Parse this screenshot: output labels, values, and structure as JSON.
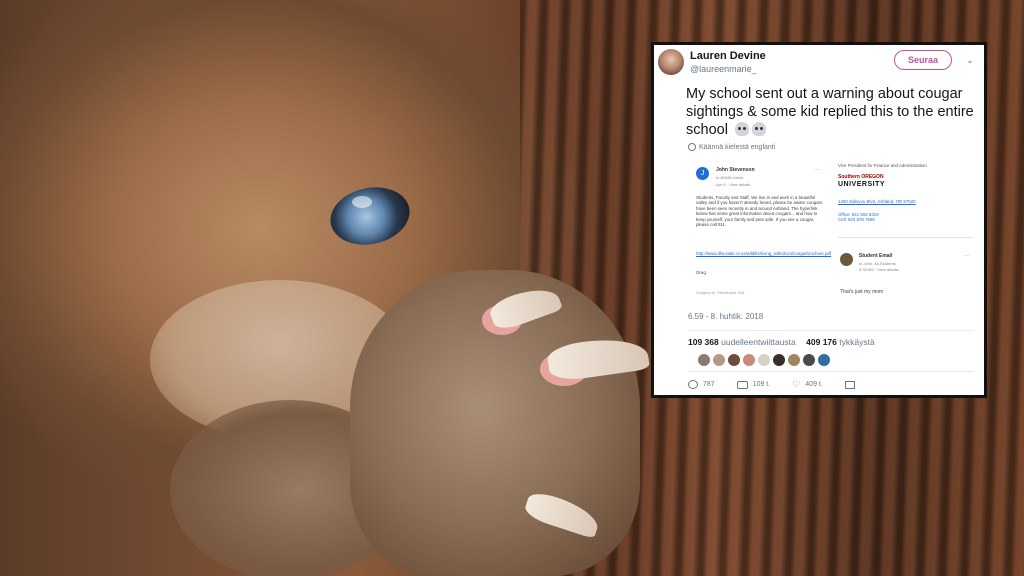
{
  "tweet": {
    "author_name": "Lauren Devine",
    "author_handle": "@laureenmarie_",
    "follow_label": "Seuraa",
    "text": "My school sent out a warning about cougar sightings & some kid replied this to the entire school",
    "translate_label": "Käännä kielestä englanti",
    "timestamp": "6.59 - 8. huhtik. 2018",
    "retweets_count": "109 368",
    "retweets_label": "uudelleentwiittausta",
    "likes_count": "409 176",
    "likes_label": "tykkäystä",
    "reply_count": "787",
    "retweet_action_count": "109 t.",
    "like_action_count": "409 t.",
    "icons": [
      "chevron-down-icon",
      "globe-icon",
      "reply-icon",
      "retweet-icon",
      "like-icon",
      "message-icon"
    ],
    "accent_color": "#c1539d"
  },
  "embedded_email": {
    "sender_initial": "J",
    "sender_name": "John Stevenson",
    "to_line": "to ANNN-Users",
    "date_line": "Apr 6 · View details",
    "body": "Students, Faculty and Staff, We live in and work in a beautiful valley and if you haven't already heard, please be aware cougars have been seen recently in and around Ashland. The hyperlink below has some great information about cougars... and how to keep yourself, your family and pets safe. If you see a cougar, please call 911.",
    "link": "http://www.dfw.state.or.us/wildlife/living_with/docs/cougarbrochure.pdf",
    "signoff": "Greg",
    "signature": "Gregory M. Stevenson, MA",
    "right_title": "Vice President for Finance and Administration",
    "university_line1": "Southern OREGON",
    "university_line2": "UNIVERSITY",
    "address": "1250 Siskiyou Blvd, Ashland, OR 97520",
    "office": "Office: 541 552 6319",
    "cell": "Cell: 503 678 7656",
    "reply_name": "Student Email",
    "reply_to": "to John, All-Students",
    "reply_time": "6:33 AM · View details",
    "reply_body": "That's just my mom"
  }
}
